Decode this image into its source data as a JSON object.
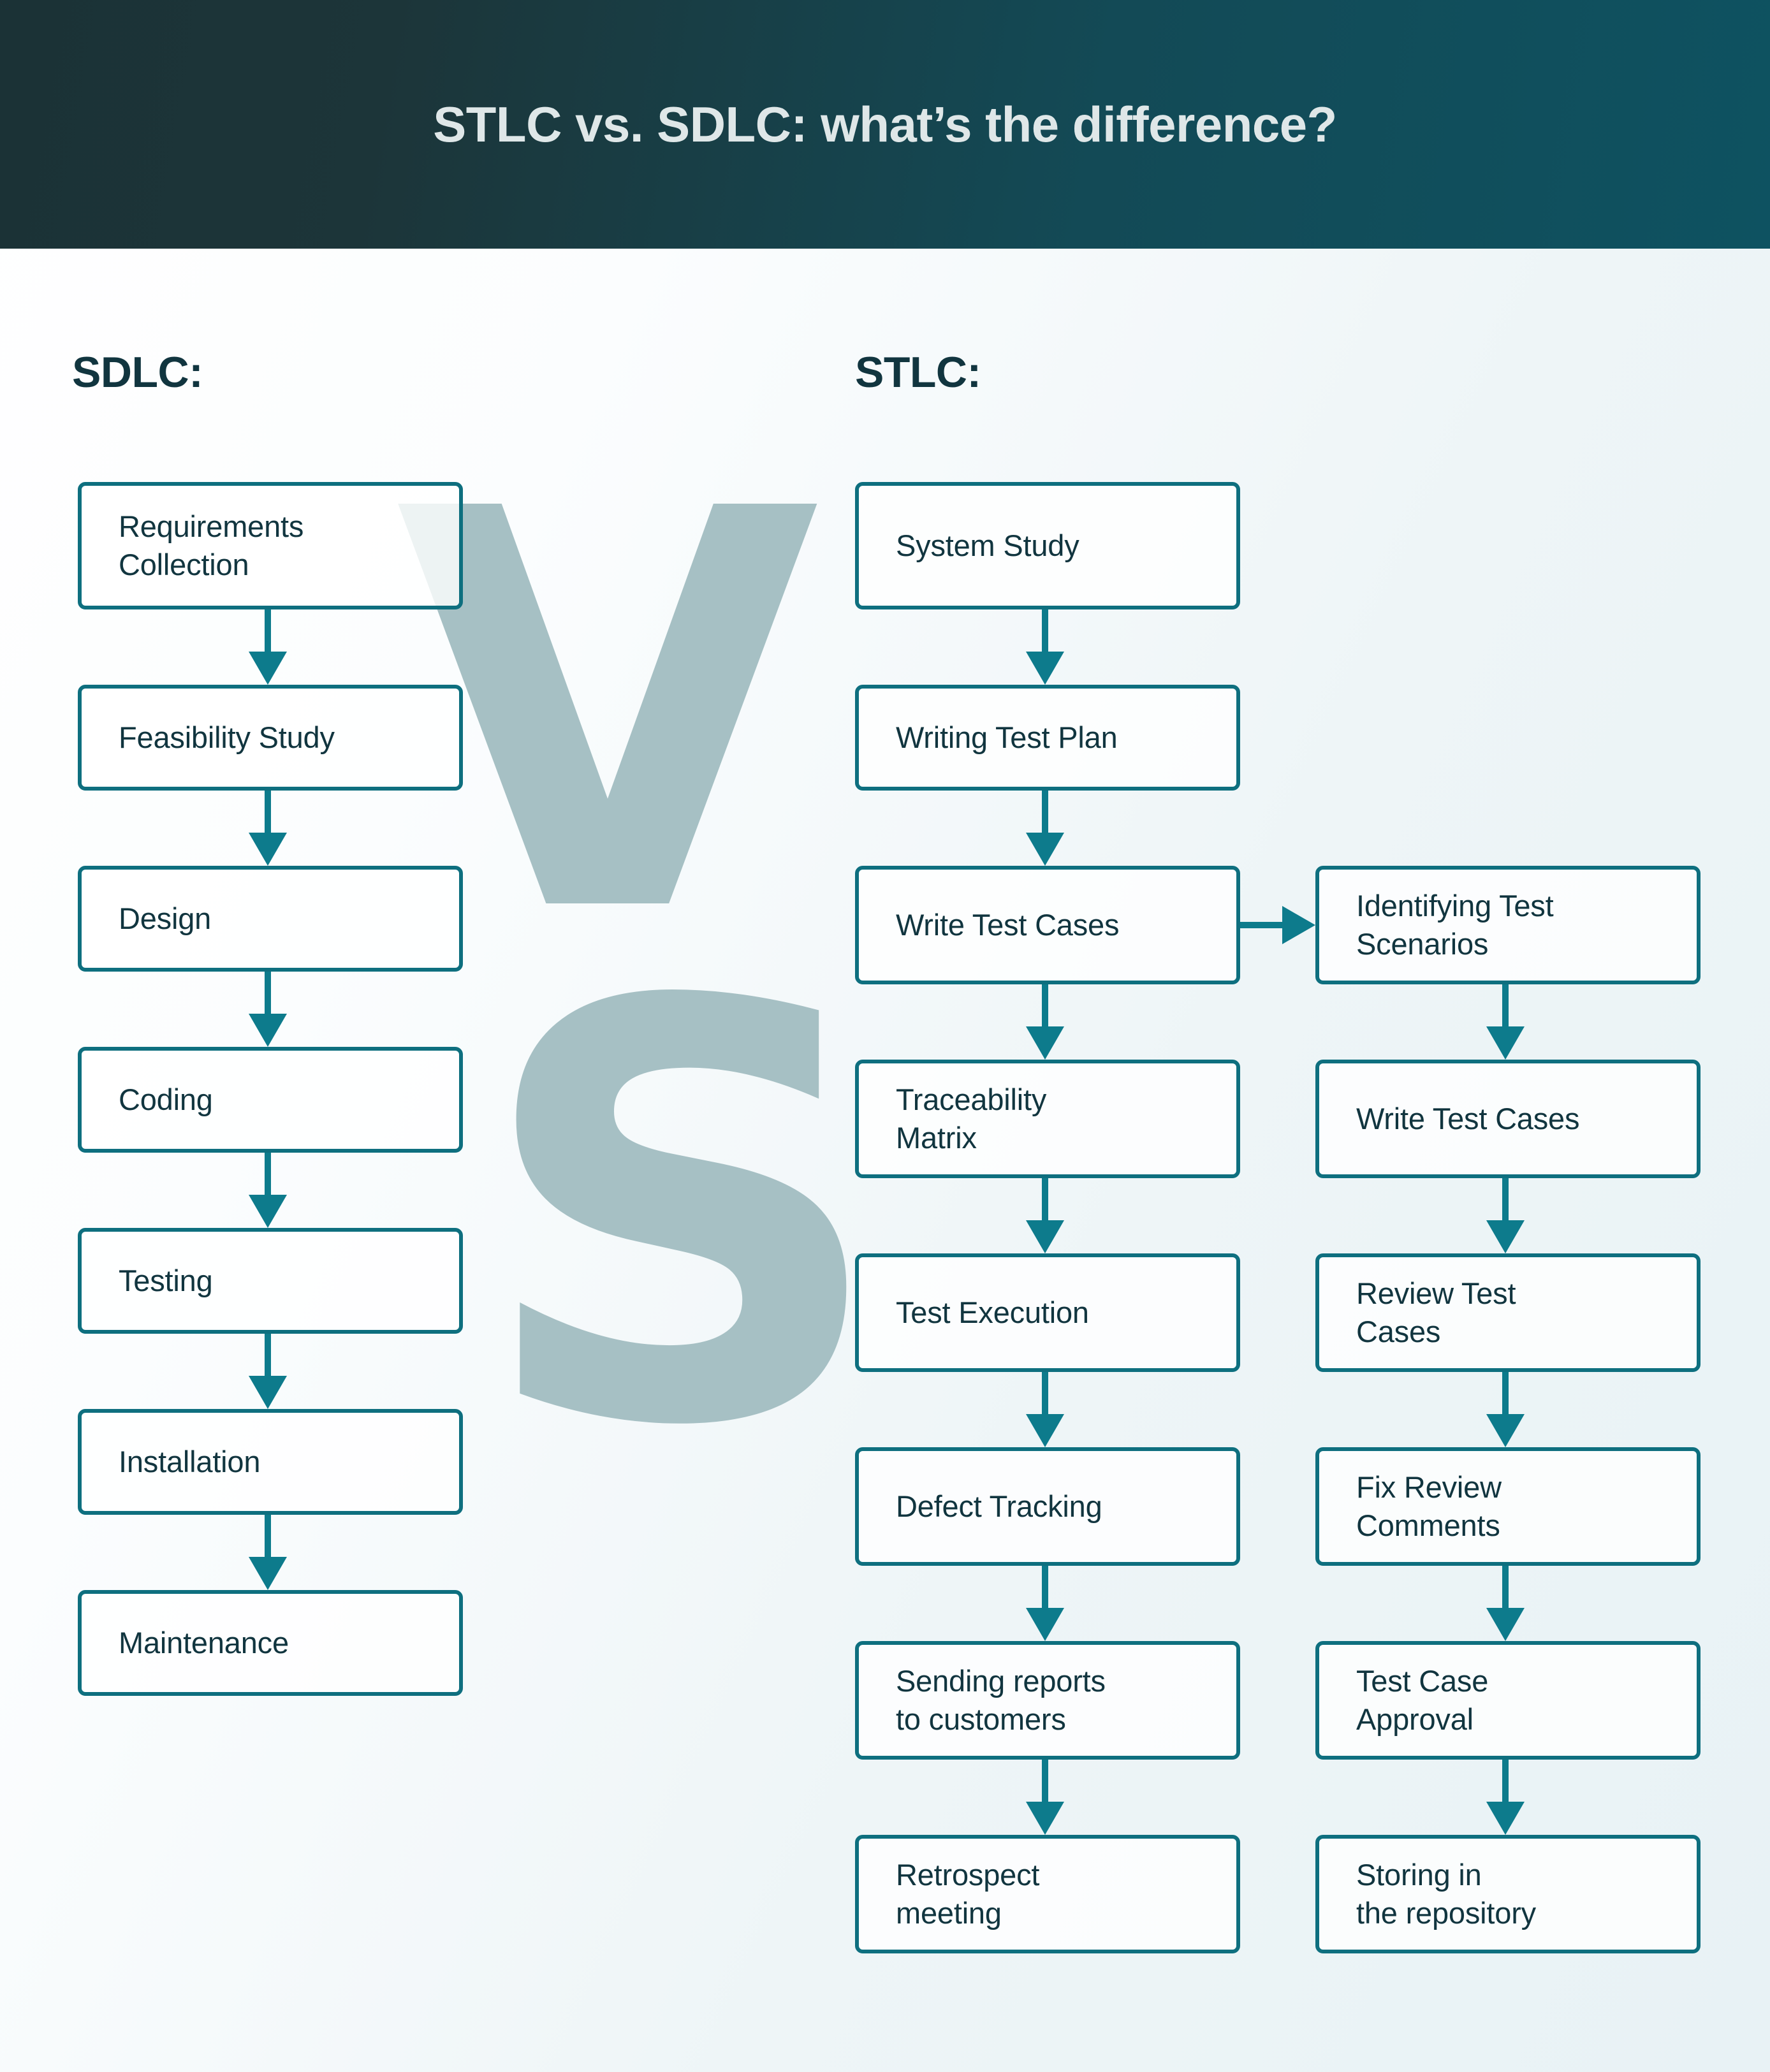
{
  "header": {
    "title": "STLC vs. SDLC: what’s the difference?",
    "bg_gradient_from": "#1b3236",
    "bg_gradient_to": "#0e5261",
    "title_color": "#dfe7e8"
  },
  "watermark": {
    "letters": [
      "V",
      "S"
    ],
    "color": "#a6c0c4"
  },
  "theme": {
    "node_border": "#0e6f7f",
    "node_fill": "#ffffff",
    "arrow": "#0d7b8c",
    "text": "#11353f",
    "page_bg_from": "#ffffff",
    "page_bg_to": "#e8f2f5"
  },
  "columns": {
    "sdlc": {
      "heading": "SDLC:",
      "nodes": [
        {
          "label": "Requirements\nCollection"
        },
        {
          "label": "Feasibility Study"
        },
        {
          "label": "Design"
        },
        {
          "label": "Coding"
        },
        {
          "label": "Testing"
        },
        {
          "label": "Installation"
        },
        {
          "label": "Maintenance"
        }
      ]
    },
    "stlc_main": {
      "heading": "STLC:",
      "nodes": [
        {
          "label": "System Study"
        },
        {
          "label": "Writing Test Plan"
        },
        {
          "label": "Write Test Cases"
        },
        {
          "label": "Traceability\nMatrix"
        },
        {
          "label": "Test Execution"
        },
        {
          "label": "Defect Tracking"
        },
        {
          "label": "Sending reports\nto customers"
        },
        {
          "label": "Retrospect\nmeeting"
        }
      ]
    },
    "stlc_branch": {
      "nodes": [
        {
          "label": "Identifying Test\nScenarios"
        },
        {
          "label": "Write Test Cases"
        },
        {
          "label": "Review Test\nCases"
        },
        {
          "label": "Fix Review\nComments"
        },
        {
          "label": "Test Case\nApproval"
        },
        {
          "label": "Storing in\nthe repository"
        }
      ]
    }
  }
}
